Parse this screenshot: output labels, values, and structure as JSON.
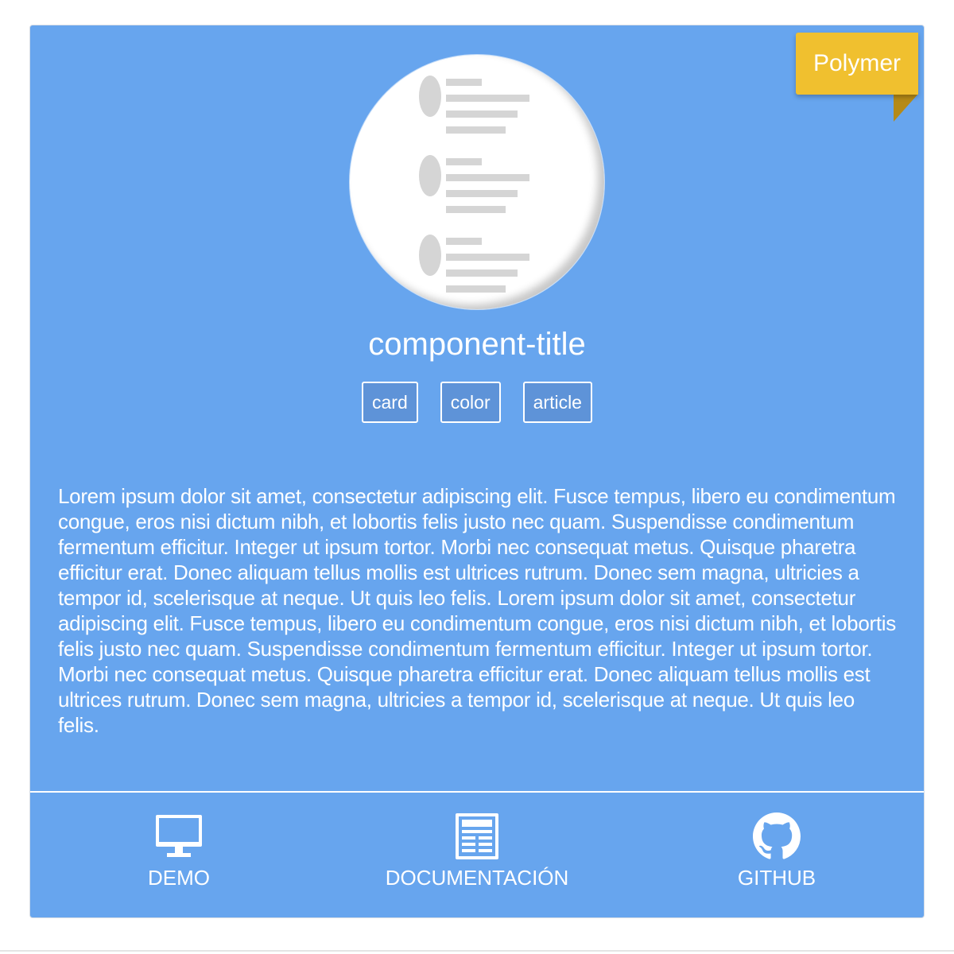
{
  "ribbon": {
    "label": "Polymer"
  },
  "card": {
    "title": "component-title",
    "tags": [
      "card",
      "color",
      "article"
    ],
    "description": "Lorem ipsum dolor sit amet, consectetur adipiscing elit. Fusce tempus, libero eu condimentum congue, eros nisi dictum nibh, et lobortis felis justo nec quam. Suspendisse condimentum fermentum efficitur. Integer ut ipsum tortor. Morbi nec consequat metus. Quisque pharetra efficitur erat. Donec aliquam tellus mollis est ultrices rutrum. Donec sem magna, ultricies a tempor id, scelerisque at neque. Ut quis leo felis. Lorem ipsum dolor sit amet, consectetur adipiscing elit. Fusce tempus, libero eu condimentum congue, eros nisi dictum nibh, et lobortis felis justo nec quam. Suspendisse condimentum fermentum efficitur. Integer ut ipsum tortor. Morbi nec consequat metus. Quisque pharetra efficitur erat. Donec aliquam tellus mollis est ultrices rutrum. Donec sem magna, ultricies a tempor id, scelerisque at neque. Ut quis leo felis."
  },
  "footer": {
    "demo": {
      "label": "DEMO",
      "icon": "monitor-icon"
    },
    "docs": {
      "label": "DOCUMENTACIÓN",
      "icon": "newspaper-icon"
    },
    "github": {
      "label": "GITHUB",
      "icon": "github-icon"
    }
  },
  "colors": {
    "card_background": "#67a5ee",
    "ribbon_background": "#f0c02f",
    "ribbon_fold": "#b58a17",
    "tag_background": "#5e93d8",
    "text": "#ffffff"
  }
}
